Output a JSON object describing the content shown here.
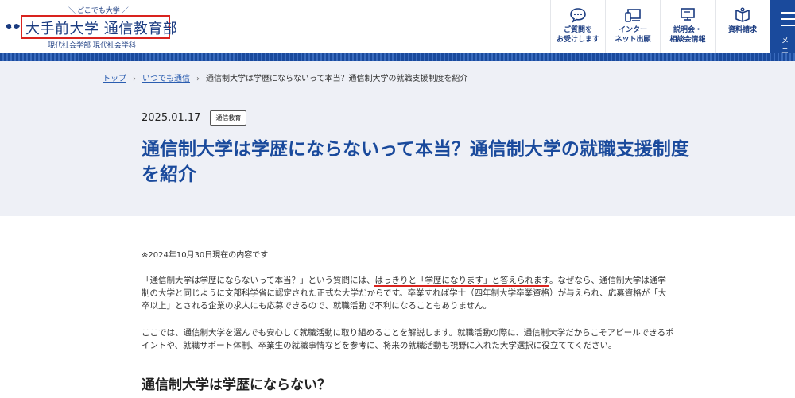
{
  "header": {
    "tagline": "どこでも大学",
    "title": "大手前大学 通信教育部",
    "subtitle": "現代社会学部 現代社会学科",
    "nav": [
      {
        "label": "ご質問を\nお受けします",
        "icon": "chat-icon"
      },
      {
        "label": "インター\nネット出願",
        "icon": "device-icon"
      },
      {
        "label": "説明会・\n相談会情報",
        "icon": "presentation-icon"
      },
      {
        "label": "資料請求",
        "icon": "book-icon"
      }
    ],
    "menu_label": "メニ"
  },
  "breadcrumb": {
    "home": "トップ",
    "category": "いつでも通信",
    "current": "通信制大学は学歴にならないって本当？通信制大学の就職支援制度を紹介"
  },
  "article": {
    "date": "2025.01.17",
    "category": "通信教育",
    "title": "通信制大学は学歴にならないって本当？通信制大学の就職支援制度を紹介",
    "note": "※2024年10月30日現在の内容です",
    "p1_before": "「通信制大学は学歴にならないって本当？」という質問には、",
    "p1_highlight": "はっきりと「学歴になります」と答えられます",
    "p1_after": "。なぜなら、通信制大学は通学制の大学と同じように文部科学省に認定された正式な大学だからです。卒業すれば学士（四年制大学卒業資格）が与えられ、応募資格が「大卒以上」とされる企業の求人にも応募できるので、就職活動で不利になることもありません。",
    "p2": "ここでは、通信制大学を選んでも安心して就職活動に取り組めることを解説します。就職活動の際に、通信制大学だからこそアピールできるポイントや、就職サポート体制、卒業生の就職事情などを参考に、将来の就職活動も視野に入れた大学選択に役立ててください。",
    "h2": "通信制大学は学歴にならない？"
  },
  "colors": {
    "brand": "#1a4a9c",
    "accent_red": "#d9231e",
    "hero_bg": "#eef0f6"
  }
}
